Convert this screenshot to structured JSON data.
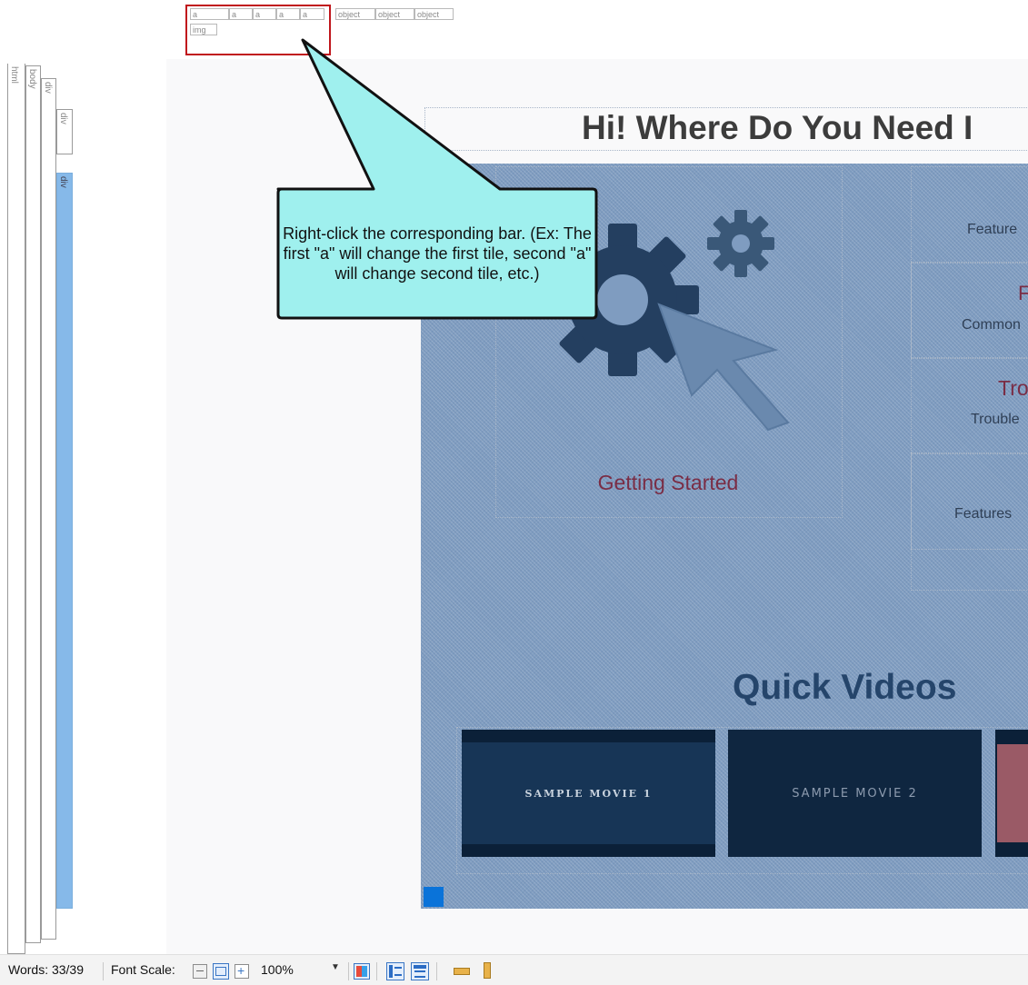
{
  "structure_bars": {
    "html": "html",
    "body": "body",
    "div1": "div",
    "div2": "div",
    "div3": "div"
  },
  "tags": {
    "row1": [
      "a",
      "a",
      "a",
      "a",
      "a"
    ],
    "objects": [
      "object",
      "object",
      "object"
    ],
    "img": "img"
  },
  "page": {
    "heading": "Hi! Where Do You Need I",
    "tile_getting_started": "Getting Started",
    "side_items": [
      "Feature",
      "F",
      "Common",
      "Tro",
      "Trouble",
      "Features"
    ],
    "quick_videos": "Quick Videos",
    "movies": [
      "SAMPLE MOVIE 1",
      "SAMPLE MOVIE 2"
    ]
  },
  "callout": {
    "text": "Right-click the corresponding bar. (Ex: The first \"a\" will change the first tile, second \"a\" will change second tile, etc.)"
  },
  "statusbar": {
    "words_label": "Words: 33/39",
    "font_scale_label": "Font Scale:",
    "zoom": "100%",
    "icons": [
      "minus-icon",
      "100-icon",
      "plus-icon",
      "dropdown-icon",
      "color-icon",
      "layout-left-icon",
      "layout-top-icon",
      "ruler-horizontal-icon",
      "ruler-vertical-icon"
    ]
  },
  "colors": {
    "overlay_blue": "#7f9cc0",
    "callout_fill": "#9ff0ee",
    "highlight_red": "#c0161c",
    "selected_bar": "#86b9e9",
    "tile_red_text": "#7a2d45",
    "quick_videos": "#25456b"
  }
}
